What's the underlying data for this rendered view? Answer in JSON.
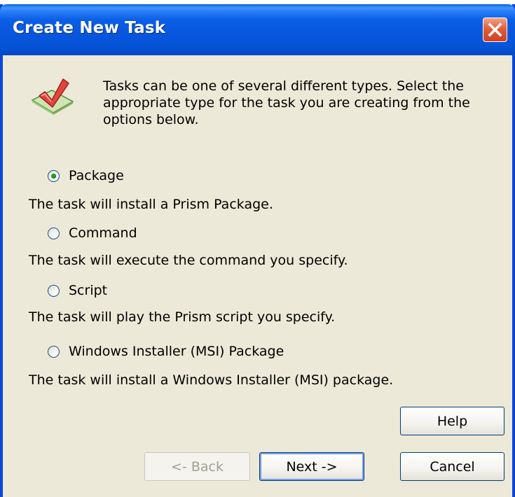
{
  "window": {
    "title": "Create New Task",
    "close_label": "X"
  },
  "intro": {
    "text": "Tasks can be one of several different types.  Select the appropriate type for the task you are creating from the options below.",
    "icon": "checkmark-task-icon"
  },
  "options": [
    {
      "label": "Package",
      "description": "The task will install a Prism Package.",
      "checked": true
    },
    {
      "label": "Command",
      "description": "The task will execute the command you specify.",
      "checked": false
    },
    {
      "label": "Script",
      "description": "The task will play the Prism script you specify.",
      "checked": false
    },
    {
      "label": "Windows Installer (MSI) Package",
      "description": "The task will install a Windows Installer (MSI) package.",
      "checked": false
    }
  ],
  "buttons": {
    "help": "Help",
    "back": "<- Back",
    "next": "Next ->",
    "cancel": "Cancel"
  },
  "colors": {
    "titlebar": "#0a5fe6",
    "dialog_bg": "#ece9d8",
    "radio_dot": "#21a121",
    "close_button": "#e35d3d"
  }
}
